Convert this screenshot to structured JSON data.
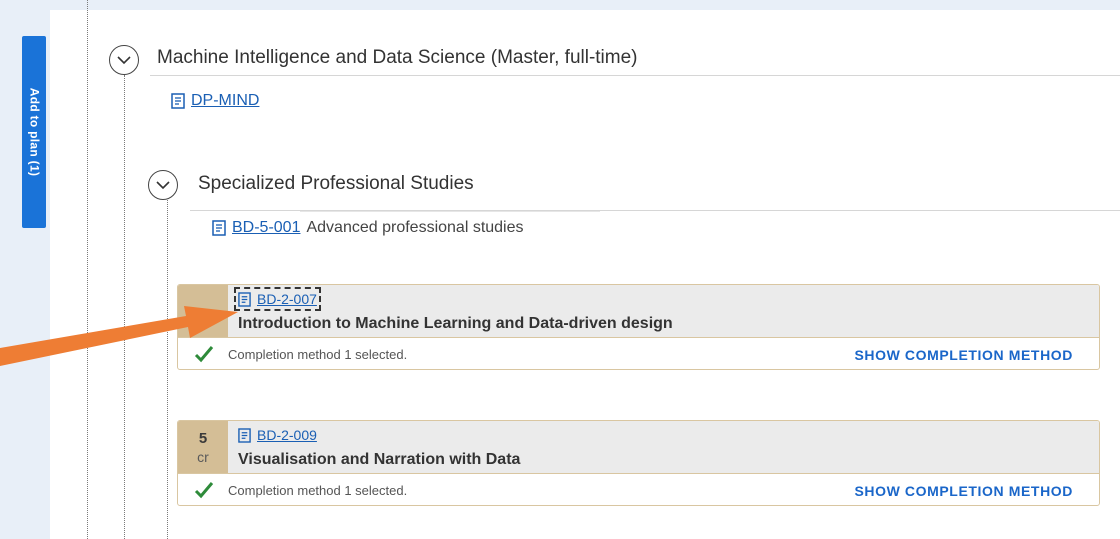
{
  "side_tab": {
    "label": "Add to plan (1)"
  },
  "program": {
    "title": "Machine Intelligence and Data Science (Master, full-time)",
    "code": "DP-MIND"
  },
  "block": {
    "title": "Specialized Professional Studies",
    "code": "BD-5-001",
    "desc": "Advanced professional studies"
  },
  "courses": [
    {
      "credits": "",
      "credits_unit": "cr",
      "code": "BD-2-007",
      "title": "Introduction to Machine Learning and Data-driven design",
      "status": "Completion method 1 selected.",
      "action": "SHOW COMPLETION METHOD"
    },
    {
      "credits": "5",
      "credits_unit": "cr",
      "code": "BD-2-009",
      "title": "Visualisation and Narration with Data",
      "status": "Completion method 1 selected.",
      "action": "SHOW COMPLETION METHOD"
    }
  ],
  "colors": {
    "accent": "#1a73d8",
    "credit_box": "#d4be96",
    "arrow": "#ee7d34",
    "check": "#2e8b3a"
  }
}
